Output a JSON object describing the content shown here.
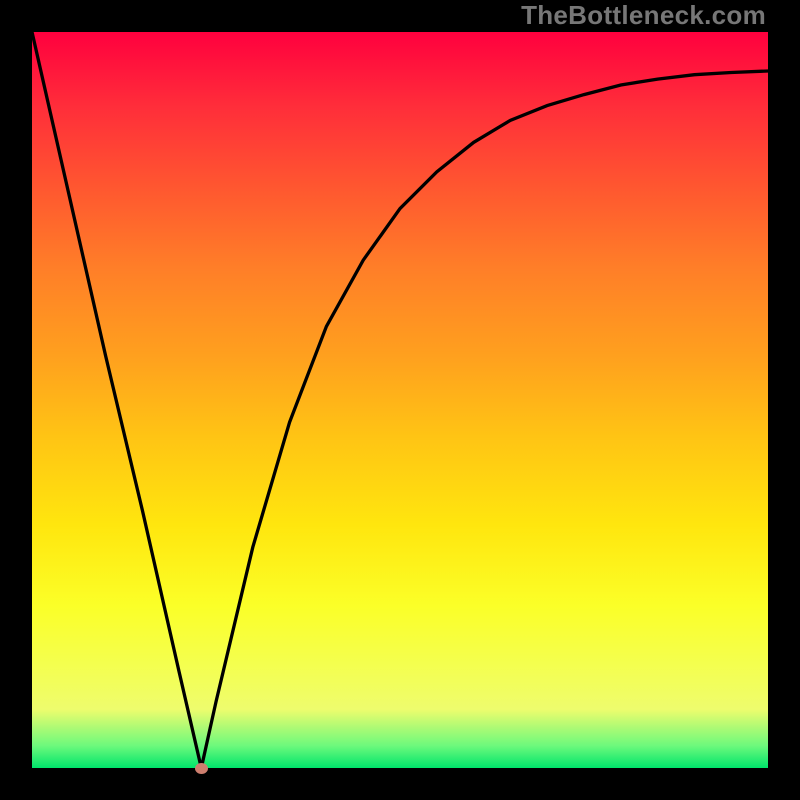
{
  "watermark": "TheBottleneck.com",
  "chart_data": {
    "type": "line",
    "title": "",
    "xlabel": "",
    "ylabel": "",
    "xlim": [
      0,
      100
    ],
    "ylim": [
      0,
      100
    ],
    "x": [
      0,
      5,
      10,
      15,
      20,
      23,
      25,
      30,
      35,
      40,
      45,
      50,
      55,
      60,
      65,
      70,
      75,
      80,
      85,
      90,
      95,
      100
    ],
    "values": [
      100,
      78,
      56,
      35,
      13,
      0,
      9,
      30,
      47,
      60,
      69,
      76,
      81,
      85,
      88,
      90,
      91.5,
      92.8,
      93.6,
      94.2,
      94.5,
      94.7
    ],
    "marker": {
      "x": 23,
      "y": 0
    },
    "gradient_stops": [
      {
        "pos": 0,
        "color": "#ff003e"
      },
      {
        "pos": 50,
        "color": "#ffe60e"
      },
      {
        "pos": 97,
        "color": "#6cf97c"
      },
      {
        "pos": 100,
        "color": "#00e56b"
      }
    ]
  }
}
